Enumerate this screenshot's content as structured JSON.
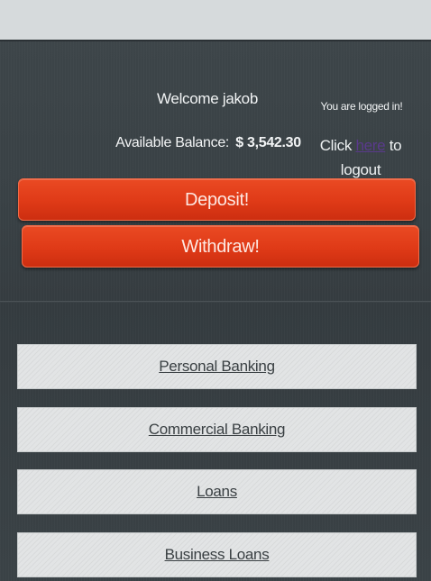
{
  "header": {
    "welcome_text": "Welcome jakob",
    "balance_label": "Available Balance:",
    "balance_amount": "$ 3,542.30",
    "logged_in_text": "You are logged in!",
    "logout_prefix": "Click ",
    "logout_link_text": "here",
    "logout_suffix": " to logout"
  },
  "actions": {
    "deposit_label": "Deposit!",
    "withdraw_label": "Withdraw!"
  },
  "menu": {
    "items": [
      {
        "label": "Personal Banking"
      },
      {
        "label": "Commercial Banking"
      },
      {
        "label": "Loans"
      },
      {
        "label": "Business Loans"
      }
    ]
  },
  "colors": {
    "accent": "#df3a17",
    "background": "#3b4246",
    "menu_background": "#e2e4e5",
    "link_visited": "#5a3a8c"
  }
}
